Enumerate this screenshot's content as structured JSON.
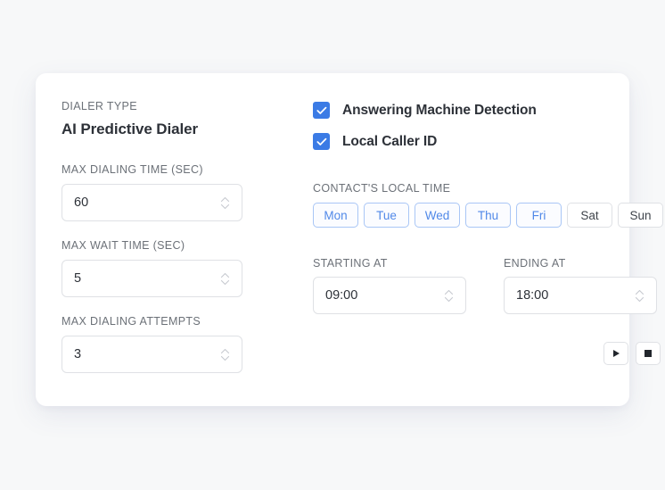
{
  "card": {
    "left_column": {
      "dialer_type_label": "DIALER TYPE",
      "dialer_type_value": "AI Predictive Dialer",
      "fields": [
        {
          "label": "MAX DIALING TIME (SEC)",
          "value": "60"
        },
        {
          "label": "MAX WAIT TIME (SEC)",
          "value": "5"
        },
        {
          "label": "MAX DIALING ATTEMPTS",
          "value": "3"
        }
      ]
    },
    "right_column": {
      "checkboxes": [
        {
          "label": "Answering Machine Detection",
          "checked": true
        },
        {
          "label": "Local Caller ID",
          "checked": true
        }
      ],
      "contact_local_time_label": "CONTACT'S LOCAL TIME",
      "days": [
        {
          "label": "Mon",
          "selected": true
        },
        {
          "label": "Tue",
          "selected": true
        },
        {
          "label": "Wed",
          "selected": true
        },
        {
          "label": "Thu",
          "selected": true
        },
        {
          "label": "Fri",
          "selected": true
        },
        {
          "label": "Sat",
          "selected": false
        },
        {
          "label": "Sun",
          "selected": false
        }
      ],
      "starting_at": {
        "label": "STARTING AT",
        "value": "09:00"
      },
      "ending_at": {
        "label": "ENDING AT",
        "value": "18:00"
      },
      "transport": [
        {
          "icon": "play-icon"
        },
        {
          "icon": "stop-icon"
        }
      ]
    }
  },
  "colors": {
    "page_background": "#f7f8f9",
    "card_background": "#ffffff",
    "accent_blue": "#3b7be5",
    "day_selected_text": "#5189e8",
    "day_selected_border": "#a9c6f6",
    "border_gray": "#dfe1e5",
    "label_gray": "#6c7178",
    "value_dark": "#2d3138"
  }
}
